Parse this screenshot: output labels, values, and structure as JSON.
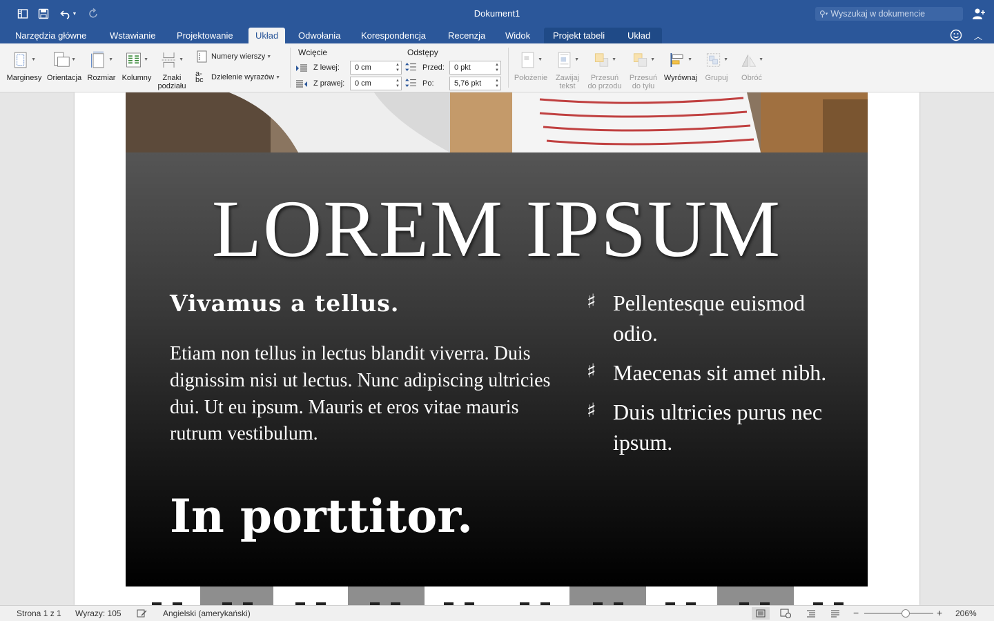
{
  "window": {
    "title": "Dokument1"
  },
  "search": {
    "placeholder": "Wyszukaj w dokumencie"
  },
  "tabs": [
    {
      "label": "Narzędzia główne"
    },
    {
      "label": "Wstawianie"
    },
    {
      "label": "Projektowanie"
    },
    {
      "label": "Układ",
      "active": true
    },
    {
      "label": "Odwołania"
    },
    {
      "label": "Korespondencja"
    },
    {
      "label": "Recenzja"
    },
    {
      "label": "Widok"
    },
    {
      "label": "Projekt tabeli"
    },
    {
      "label": "Układ"
    }
  ],
  "ribbon": {
    "marginesy": "Marginesy",
    "orientacja": "Orientacja",
    "rozmiar": "Rozmiar",
    "kolumny": "Kolumny",
    "znaki_line1": "Znaki",
    "znaki_line2": "podziału",
    "numery": "Numery wierszy",
    "dzielenie": "Dzielenie wyrazów",
    "wciecie_title": "Wcięcie",
    "z_lewej_label": "Z lewej:",
    "z_lewej_value": "0 cm",
    "z_prawej_label": "Z prawej:",
    "z_prawej_value": "0 cm",
    "odstepy_title": "Odstępy",
    "przed_label": "Przed:",
    "przed_value": "0 pkt",
    "po_label": "Po:",
    "po_value": "5,76 pkt",
    "polozenie": "Położenie",
    "zawijaj_line1": "Zawijaj",
    "zawijaj_line2": "tekst",
    "przesun_przod_line1": "Przesuń",
    "przesun_przod_line2": "do przodu",
    "przesun_tyl_line1": "Przesuń",
    "przesun_tyl_line2": "do tyłu",
    "wyrownaj": "Wyrównaj",
    "grupuj": "Grupuj",
    "obroc": "Obróć"
  },
  "document": {
    "hero": "LOREM IPSUM",
    "subtitle": "Vivamus a tellus.",
    "body": "Etiam non tellus in lectus blandit viverra. Duis dignissim nisi ut lectus. Nunc adipiscing ultricies dui. Ut eu ipsum. Mauris et eros vitae mauris rutrum vestibulum.",
    "big_heading": "In porttitor.",
    "bullets": [
      "Pellentesque euismod odio.",
      "Maecenas sit amet nibh.",
      "Duis ultricies purus nec ipsum."
    ]
  },
  "status": {
    "page": "Strona 1 z 1",
    "words": "Wyrazy: 105",
    "language": "Angielski (amerykański)",
    "zoom": "206%",
    "zoom_fraction": 0.6
  },
  "colors": {
    "accent": "#2b579a",
    "ribbon_bg": "#f3f3f3"
  }
}
